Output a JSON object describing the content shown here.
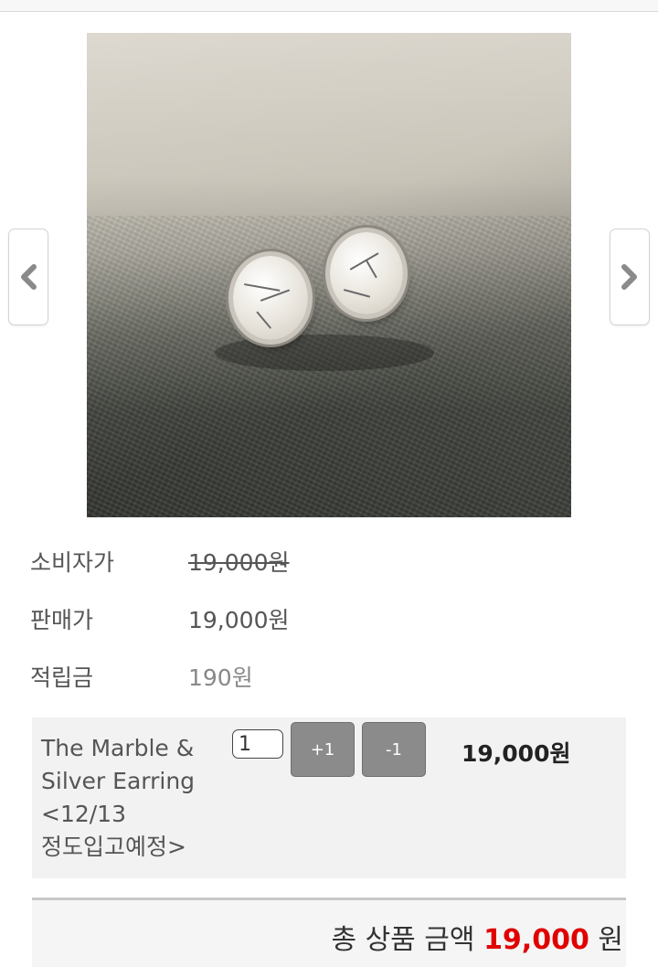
{
  "gallery": {
    "image_alt": "The Marble & Silver Earring product photo",
    "prev_icon": "chevron-left-icon",
    "next_icon": "chevron-right-icon"
  },
  "price_info": {
    "consumer_price_label": "소비자가",
    "consumer_price_value": "19,000원",
    "sale_price_label": "판매가",
    "sale_price_value": "19,000원",
    "mileage_label": "적립금",
    "mileage_value": "190원"
  },
  "option": {
    "name_line1": "The Marble &",
    "name_line2": "Silver Earring",
    "name_line3": "<12/13",
    "name_line4": "정도입고예정>",
    "quantity": "1",
    "plus_label": "+1",
    "minus_label": "-1",
    "price": "19,000원"
  },
  "total": {
    "label": "총 상품 금액",
    "amount": "19,000",
    "unit": "원"
  },
  "colors": {
    "total_amount": "#e00000",
    "qty_button": "#8b8b8b",
    "option_background": "#f2f2f2"
  }
}
